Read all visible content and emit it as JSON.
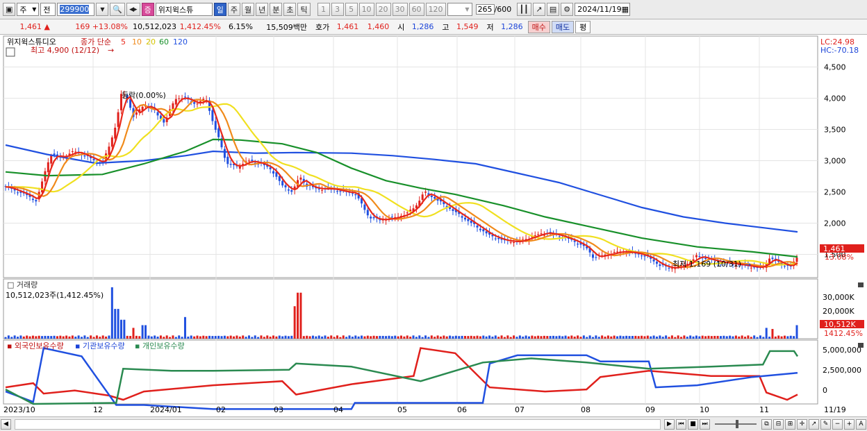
{
  "toolbar": {
    "market": "주",
    "scope": "전",
    "stock_code": "299900",
    "stock_name": "위지윅스튜",
    "stock_badge": "증",
    "periods": [
      "일",
      "주",
      "월",
      "년",
      "분",
      "초",
      "틱"
    ],
    "active_period": "일",
    "intervals": [
      "1",
      "3",
      "5",
      "10",
      "20",
      "30",
      "60",
      "120"
    ],
    "count": "265",
    "count_max": "/600",
    "date": "2024/11/19"
  },
  "quote": {
    "price": "1,461",
    "change": "169",
    "change_pct": "+13.08%",
    "volume": "10,512,023",
    "volume_pct": "1,412.45%",
    "turnover_pct": "6.15%",
    "amount": "15,509백만",
    "bid_label": "호가",
    "ask_price": "1,461",
    "bid_price": "1,460",
    "open_label": "시",
    "open": "1,286",
    "high_label": "고",
    "high": "1,549",
    "low_label": "저",
    "low": "1,286",
    "buy_label": "매수",
    "sell_label": "매도",
    "eval_label": "평"
  },
  "price_panel": {
    "legend_name": "위지윅스튜디오",
    "legend_ma": "종가 단순",
    "ma_periods": [
      "5",
      "10",
      "20",
      "60",
      "120"
    ],
    "ma_colors": [
      "#e8281a",
      "#f08a1a",
      "#f0e020",
      "#18902a",
      "#2050e0"
    ],
    "high_annot": "최고 4,900 (12/12)",
    "low_annot": "최저 1,169 (10/31)",
    "mid_annot": "등락(0.00%)",
    "lc": "LC:24.98",
    "hc": "HC:-70.18",
    "current_price": "1,461",
    "current_pct": "13.08%",
    "y_ticks": [
      "4,500",
      "4,000",
      "3,500",
      "3,000",
      "2,500",
      "2,000",
      "1,500"
    ]
  },
  "volume_panel": {
    "title": "거래량",
    "value": "10,512,023주(1,412.45%)",
    "y_ticks": [
      "30,000K",
      "20,000K"
    ],
    "current": "10,512K",
    "current_pct": "1412.45%"
  },
  "holdings_panel": {
    "legend": [
      "외국인보유수량",
      "기관보유수량",
      "개인보유수량"
    ],
    "colors": [
      "#e0201c",
      "#2050e0",
      "#2a8a50"
    ],
    "y_ticks": [
      "5,000,000",
      "2,500,000",
      "0"
    ]
  },
  "x_axis": [
    "2023/10",
    "12",
    "2024/01",
    "02",
    "03",
    "04",
    "05",
    "06",
    "07",
    "08",
    "09",
    "10",
    "11",
    "11/19"
  ],
  "chart_data": {
    "type": "candlestick",
    "x_labels": [
      "2023/10",
      "12",
      "2024/01",
      "02",
      "03",
      "04",
      "05",
      "06",
      "07",
      "08",
      "09",
      "10",
      "11",
      "11/19"
    ],
    "ylim": [
      1150,
      4950
    ],
    "close_series": [
      [
        0,
        2580
      ],
      [
        30,
        2450
      ],
      [
        45,
        2350
      ],
      [
        55,
        2750
      ],
      [
        65,
        3100
      ],
      [
        80,
        3050
      ],
      [
        100,
        3150
      ],
      [
        120,
        3050
      ],
      [
        140,
        2950
      ],
      [
        152,
        3300
      ],
      [
        160,
        3600
      ],
      [
        168,
        4100
      ],
      [
        176,
        4000
      ],
      [
        185,
        3700
      ],
      [
        200,
        3900
      ],
      [
        215,
        3800
      ],
      [
        230,
        3600
      ],
      [
        245,
        4000
      ],
      [
        260,
        4000
      ],
      [
        275,
        3900
      ],
      [
        290,
        4000
      ],
      [
        300,
        3600
      ],
      [
        310,
        3300
      ],
      [
        320,
        2950
      ],
      [
        335,
        2900
      ],
      [
        350,
        3000
      ],
      [
        370,
        2950
      ],
      [
        385,
        2850
      ],
      [
        400,
        2600
      ],
      [
        415,
        2500
      ],
      [
        425,
        2750
      ],
      [
        435,
        2600
      ],
      [
        450,
        2550
      ],
      [
        470,
        2550
      ],
      [
        490,
        2500
      ],
      [
        505,
        2480
      ],
      [
        515,
        2300
      ],
      [
        525,
        2100
      ],
      [
        540,
        2050
      ],
      [
        560,
        2080
      ],
      [
        580,
        2150
      ],
      [
        595,
        2300
      ],
      [
        605,
        2500
      ],
      [
        620,
        2400
      ],
      [
        640,
        2250
      ],
      [
        660,
        2100
      ],
      [
        680,
        1950
      ],
      [
        700,
        1800
      ],
      [
        720,
        1720
      ],
      [
        740,
        1700
      ],
      [
        760,
        1780
      ],
      [
        780,
        1850
      ],
      [
        800,
        1800
      ],
      [
        820,
        1720
      ],
      [
        840,
        1600
      ],
      [
        850,
        1450
      ],
      [
        870,
        1500
      ],
      [
        890,
        1550
      ],
      [
        910,
        1520
      ],
      [
        930,
        1450
      ],
      [
        945,
        1330
      ],
      [
        960,
        1280
      ],
      [
        975,
        1300
      ],
      [
        990,
        1380
      ],
      [
        1000,
        1480
      ],
      [
        1015,
        1420
      ],
      [
        1030,
        1380
      ],
      [
        1050,
        1350
      ],
      [
        1070,
        1320
      ],
      [
        1085,
        1290
      ],
      [
        1095,
        1300
      ],
      [
        1105,
        1450
      ],
      [
        1115,
        1380
      ],
      [
        1125,
        1330
      ],
      [
        1135,
        1300
      ],
      [
        1145,
        1461
      ]
    ],
    "ma120_series": [
      [
        0,
        3250
      ],
      [
        60,
        3100
      ],
      [
        130,
        2960
      ],
      [
        200,
        3000
      ],
      [
        260,
        3080
      ],
      [
        300,
        3150
      ],
      [
        360,
        3120
      ],
      [
        420,
        3130
      ],
      [
        500,
        3120
      ],
      [
        560,
        3080
      ],
      [
        620,
        3020
      ],
      [
        680,
        2950
      ],
      [
        740,
        2800
      ],
      [
        800,
        2650
      ],
      [
        860,
        2450
      ],
      [
        920,
        2250
      ],
      [
        980,
        2100
      ],
      [
        1040,
        2000
      ],
      [
        1100,
        1920
      ],
      [
        1145,
        1860
      ]
    ],
    "ma60_series": [
      [
        0,
        2820
      ],
      [
        60,
        2760
      ],
      [
        140,
        2780
      ],
      [
        200,
        2950
      ],
      [
        260,
        3150
      ],
      [
        300,
        3340
      ],
      [
        340,
        3330
      ],
      [
        400,
        3270
      ],
      [
        450,
        3130
      ],
      [
        500,
        2880
      ],
      [
        550,
        2680
      ],
      [
        600,
        2560
      ],
      [
        650,
        2460
      ],
      [
        720,
        2280
      ],
      [
        780,
        2100
      ],
      [
        850,
        1930
      ],
      [
        920,
        1760
      ],
      [
        1000,
        1620
      ],
      [
        1080,
        1540
      ],
      [
        1145,
        1460
      ]
    ]
  }
}
